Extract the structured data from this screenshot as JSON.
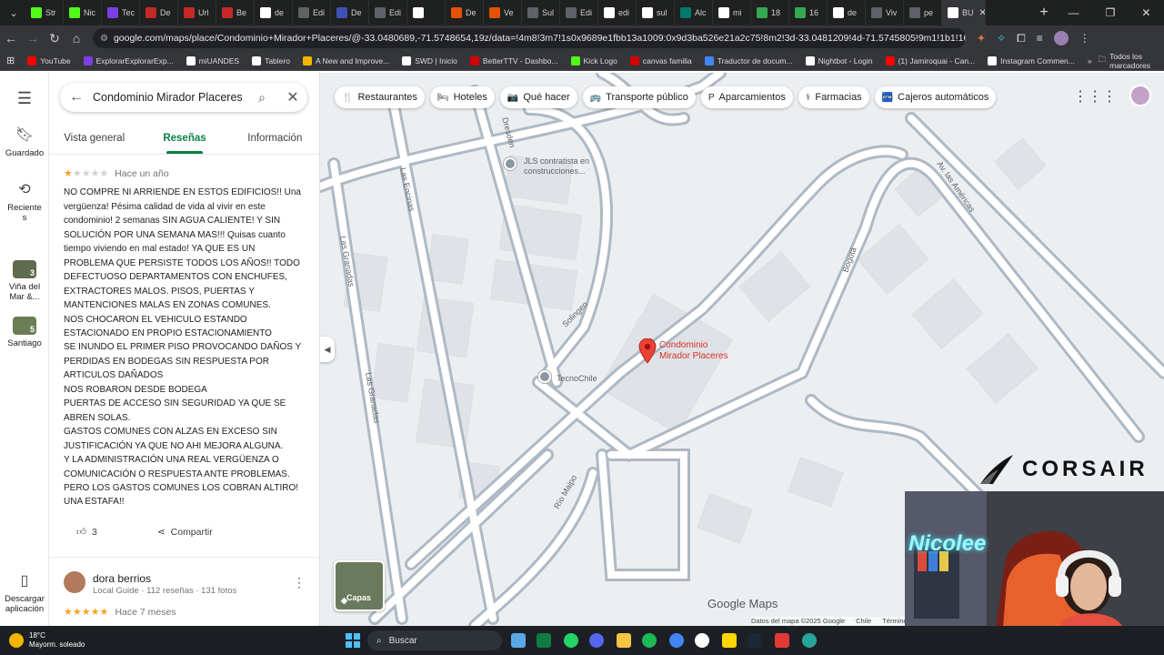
{
  "browser": {
    "tabs": [
      {
        "label": "Str",
        "color": "#53fc18"
      },
      {
        "label": "Nic",
        "color": "#53fc18"
      },
      {
        "label": "Tec",
        "color": "#7b3fe4"
      },
      {
        "label": "De",
        "color": "#c62828"
      },
      {
        "label": "Url",
        "color": "#c62828"
      },
      {
        "label": "Be",
        "color": "#c62828"
      },
      {
        "label": "de",
        "color": "#ffffff"
      },
      {
        "label": "Edi",
        "color": "#5f6368"
      },
      {
        "label": "De",
        "color": "#3f51b5"
      },
      {
        "label": "Edi",
        "color": "#5f6368"
      },
      {
        "label": "",
        "color": "#ffffff"
      },
      {
        "label": "De",
        "color": "#e65100"
      },
      {
        "label": "Ve",
        "color": "#e65100"
      },
      {
        "label": "Sul",
        "color": "#5f6368"
      },
      {
        "label": "Edi",
        "color": "#5f6368"
      },
      {
        "label": "edi",
        "color": "#ffffff"
      },
      {
        "label": "sul",
        "color": "#ffffff"
      },
      {
        "label": "Alc",
        "color": "#00796b"
      },
      {
        "label": "mi",
        "color": "#ffffff"
      },
      {
        "label": "18",
        "color": "#34a853"
      },
      {
        "label": "16",
        "color": "#34a853"
      },
      {
        "label": "de",
        "color": "#ffffff"
      },
      {
        "label": "Viv",
        "color": "#5f6368"
      },
      {
        "label": "pe",
        "color": "#5f6368"
      },
      {
        "label": "BU",
        "color": "#ffffff"
      }
    ],
    "active_tab_close": "✕",
    "new_tab": "+",
    "window_controls": [
      "—",
      "❐",
      "✕"
    ],
    "url": "google.com/maps/place/Condominio+Mirador+Placeres/@-33.0480689,-71.5748654,19z/data=!4m8!3m7!1s0x9689e1fbb13a1009:0x9d3ba526e21a2c75!8m2!3d-33.0481209!4d-71.5745805!9m1!1b1!16s%2Fg%2F11fnxbz...",
    "bookmarks": [
      {
        "label": "YouTube",
        "color": "#ff0000"
      },
      {
        "label": "ExplorarExplorarExp...",
        "color": "#7b3fe4"
      },
      {
        "label": "miUANDES",
        "color": "#ffffff"
      },
      {
        "label": "Tablero",
        "color": "#ffffff"
      },
      {
        "label": "A New and Improve...",
        "color": "#f4b400"
      },
      {
        "label": "SWD | Inicio",
        "color": "#ffffff"
      },
      {
        "label": "BetterTTV - Dashbo...",
        "color": "#d50000"
      },
      {
        "label": "Kick Logo",
        "color": "#53fc18"
      },
      {
        "label": "canvas familia",
        "color": "#d50000"
      },
      {
        "label": "Traductor de docum...",
        "color": "#4285f4"
      },
      {
        "label": "Nightbot - Login",
        "color": "#ffffff"
      },
      {
        "label": "(1) Jamiroquai - Can...",
        "color": "#ff0000"
      },
      {
        "label": "Instagram Commen...",
        "color": "#ffffff"
      }
    ],
    "bookmarks_more": "»",
    "all_bookmarks": "Todos los marcadores"
  },
  "rail": {
    "saved": "Guardado",
    "recent": "Recientes",
    "recent_line1": "Reciente",
    "recent_line2": "s",
    "place1_line1": "Viña del",
    "place1_line2": "Mar &...",
    "place2": "Santiago",
    "place2_badge": "5",
    "place1_badge": "3",
    "download_line1": "Descargar",
    "download_line2": "aplicación"
  },
  "panel": {
    "search_value": "Condominio Mirador Placeres",
    "tabs": [
      "Vista general",
      "Reseñas",
      "Información"
    ],
    "review1": {
      "rating": 1,
      "when": "Hace un año",
      "text_first": "NO COMPRE NI ARRIENDE EN ESTOS EDIFICIOS!! Una vergüenza! Pésima calidad de vida al vivir en este condominio! 2 semanas SIN AGUA CALIENTE! Y SIN SOLUCIÓN POR UNA SEMANA MAS!!! Quisas cuanto tiempo viviendo en mal estado! YA QUE ES UN PROBLEMA QUE PERSISTE TODOS LOS AÑOS!! TODO DEFECTUOSO DEPARTAMENTOS CON ENCHUFES, EXTRACTORES MALOS. PISOS, PUERTAS Y MANTENCIONES MALAS EN ZONAS COMUNES.",
      "text_rest": "NOS CHOCARON EL VEHICULO ESTANDO ESTACIONADO EN PROPIO ESTACIONAMIENTO\nSE INUNDO EL PRIMER PISO PROVOCANDO DAÑOS Y PERDIDAS EN BODEGAS SIN RESPUESTA POR ARTICULOS DAÑADOS\nNOS ROBARON DESDE BODEGA\nPUERTAS DE ACCESO SIN SEGURIDAD YA QUE SE ABREN SOLAS.\nGASTOS COMUNES CON ALZAS EN EXCESO SIN JUSTIFICACIÓN YA QUE NO AHI MEJORA ALGUNA.\nY LA ADMINISTRACIÓN UNA REAL VERGÜENZA O COMUNICACIÓN O RESPUESTA ANTE PROBLEMAS.\nPERO LOS GASTOS COMUNES LOS COBRAN ALTIRO!\nUNA ESTAFA!!",
      "likes": "3",
      "share": "Compartir"
    },
    "review2": {
      "name": "dora berrios",
      "meta": "Local Guide · 112 reseñas · 131 fotos",
      "rating": 5,
      "when": "Hace 7 meses"
    }
  },
  "map": {
    "chips": [
      {
        "label": "Restaurantes",
        "icon": "fork-knife-icon",
        "glyph": "🍴"
      },
      {
        "label": "Hoteles",
        "icon": "bed-icon",
        "glyph": "🛏"
      },
      {
        "label": "Qué hacer",
        "icon": "camera-icon",
        "glyph": "📷"
      },
      {
        "label": "Transporte público",
        "icon": "bus-icon",
        "glyph": "🚌"
      },
      {
        "label": "Aparcamientos",
        "icon": "parking-icon",
        "glyph": "P"
      },
      {
        "label": "Farmacias",
        "icon": "pharmacy-icon",
        "glyph": "⚕"
      },
      {
        "label": "Cajeros automáticos",
        "icon": "atm-icon",
        "glyph": "🏧"
      }
    ],
    "street_labels": [
      "Las Granadas",
      "Las Encinas",
      "Dresden",
      "Solingen",
      "Bogotá",
      "Av. las Américas",
      "Río Maipo",
      "Las Granadas"
    ],
    "poi": [
      {
        "label_line1": "JLS contratista en",
        "label_line2": "construcciones..."
      },
      {
        "label_line1": "TecnoChile",
        "label_line2": ""
      }
    ],
    "pin_label_line1": "Condominio",
    "pin_label_line2": "Mirador Placeres",
    "layers": "Capas",
    "logo": "Google Maps",
    "attribution": [
      "Datos del mapa ©2025 Google",
      "Chile",
      "Términos"
    ]
  },
  "overlay": {
    "brand": "CORSAIR",
    "neon": "Nicolee"
  },
  "taskbar": {
    "temp": "18°C",
    "weather": "Mayorm. soleado",
    "search": "Buscar"
  }
}
